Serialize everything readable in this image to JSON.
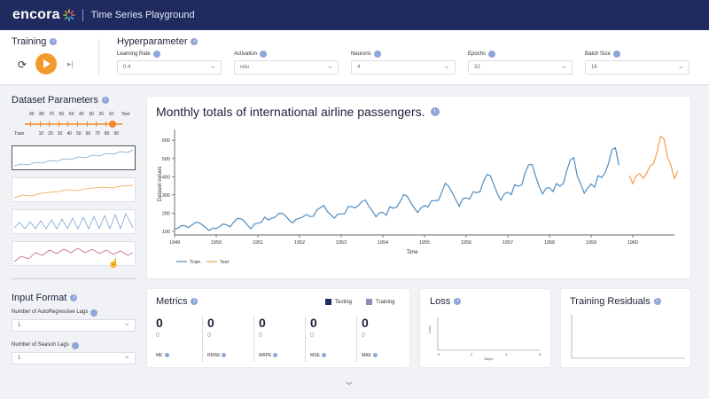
{
  "header": {
    "logo": "encora",
    "app_title": "Time Series Playground"
  },
  "training": {
    "title": "Training"
  },
  "hyper": {
    "title": "Hyperparameter",
    "fields": [
      {
        "label": "Learning Rate",
        "value": "0.4"
      },
      {
        "label": "Activation",
        "value": "relu"
      },
      {
        "label": "Neurons",
        "value": "4"
      },
      {
        "label": "Epochs",
        "value": "32"
      },
      {
        "label": "Batch Size",
        "value": "16"
      }
    ]
  },
  "dataset": {
    "title": "Dataset Parameters",
    "test_ticks": [
      "90",
      "80",
      "70",
      "60",
      "50",
      "40",
      "30",
      "20",
      "10",
      "Test"
    ],
    "train_ticks": [
      "Train",
      "10",
      "20",
      "30",
      "40",
      "50",
      "60",
      "70",
      "80",
      "90"
    ],
    "split_train_pct": 90
  },
  "input_format": {
    "title": "Input Format",
    "ar_label": "Number of AutoRegressive Lags",
    "ar_value": "1",
    "season_label": "Number of Season Lags",
    "season_value": "1"
  },
  "chart": {
    "title": "Monthly totals of international airline passengers.",
    "ylabel": "Dataset values",
    "xlabel": "Time",
    "legend_train": "Train",
    "legend_test": "Test",
    "train_color": "#4e8cc2",
    "test_color": "#f0a04b"
  },
  "chart_data": {
    "type": "line",
    "title": "Monthly totals of international airline passengers.",
    "xlabel": "Time",
    "ylabel": "Dataset values",
    "xlim": [
      1949,
      1961
    ],
    "ylim": [
      80,
      640
    ],
    "x_ticks": [
      "1949",
      "1950",
      "1951",
      "1952",
      "1953",
      "1954",
      "1955",
      "1956",
      "1957",
      "1958",
      "1959",
      "1960"
    ],
    "y_ticks": [
      100,
      200,
      300,
      400,
      500,
      600
    ],
    "series": [
      {
        "name": "Train",
        "start": 1949.0,
        "values": [
          112,
          118,
          132,
          129,
          121,
          135,
          148,
          148,
          136,
          119,
          104,
          118,
          115,
          126,
          141,
          135,
          125,
          149,
          170,
          170,
          158,
          133,
          114,
          140,
          145,
          150,
          178,
          163,
          172,
          178,
          199,
          199,
          184,
          162,
          146,
          166,
          171,
          180,
          193,
          181,
          183,
          218,
          230,
          242,
          209,
          191,
          172,
          194,
          196,
          196,
          236,
          235,
          229,
          243,
          264,
          272,
          237,
          211,
          180,
          201,
          204,
          188,
          235,
          227,
          234,
          264,
          302,
          293,
          259,
          229,
          203,
          229,
          242,
          233,
          267,
          269,
          270,
          315,
          364,
          347,
          312,
          274,
          237,
          278,
          284,
          277,
          317,
          313,
          318,
          374,
          413,
          405,
          355,
          306,
          271,
          306,
          315,
          301,
          356,
          348,
          355,
          422,
          465,
          467,
          404,
          347,
          305,
          336,
          340,
          318,
          362,
          348,
          363,
          435,
          491,
          505,
          404,
          359,
          310,
          337,
          360,
          342,
          406,
          396,
          420,
          472,
          548,
          559,
          463
        ]
      },
      {
        "name": "Test",
        "start": 1959.9167,
        "values": [
          407,
          362,
          405,
          417,
          391,
          419,
          461,
          472,
          535,
          622,
          606,
          508,
          461,
          390,
          432
        ]
      }
    ],
    "grid": false,
    "legend": "bottom-left"
  },
  "metrics": {
    "title": "Metrics",
    "legend_testing": "Testing",
    "legend_training": "Training",
    "testing_color": "#1f2b5e",
    "training_color": "#8d91b8",
    "items": [
      {
        "name": "ME",
        "value": "0",
        "sub": "0"
      },
      {
        "name": "RMSE",
        "value": "0",
        "sub": "0"
      },
      {
        "name": "MAPE",
        "value": "0",
        "sub": "0"
      },
      {
        "name": "MSE",
        "value": "0",
        "sub": "0"
      },
      {
        "name": "MAE",
        "value": "0",
        "sub": "0"
      }
    ]
  },
  "loss": {
    "title": "Loss",
    "ylabel": "Loss",
    "xlabel": "Steps",
    "x_ticks": [
      "0",
      "2",
      "4",
      "6"
    ]
  },
  "residuals": {
    "title": "Training Residuals"
  }
}
